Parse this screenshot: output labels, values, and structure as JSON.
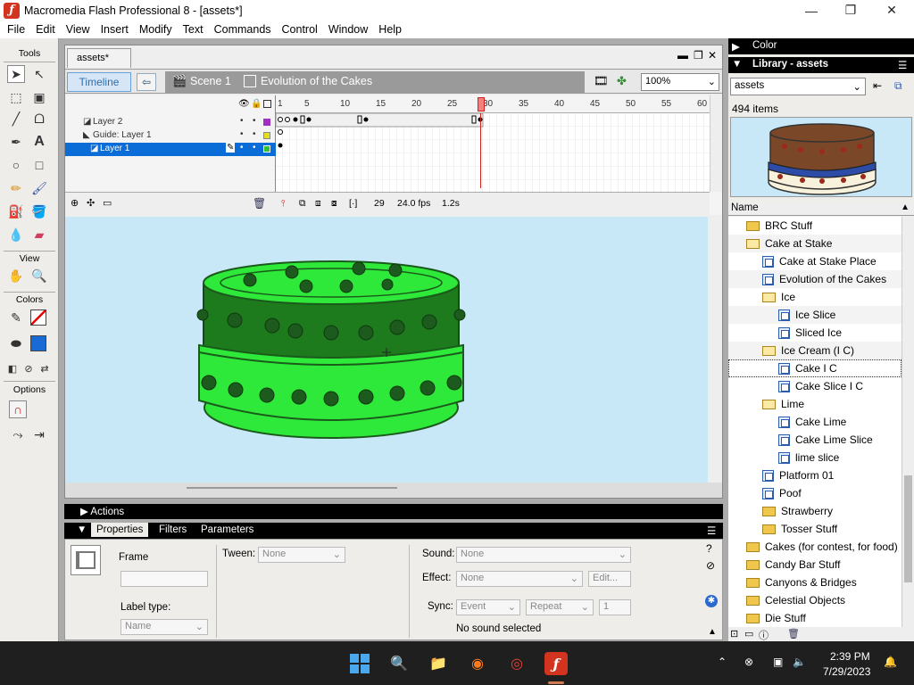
{
  "window": {
    "title": "Macromedia Flash Professional 8 - [assets*]",
    "minimize": "—",
    "maximize": "❐",
    "close": "✕"
  },
  "menu": [
    "File",
    "Edit",
    "View",
    "Insert",
    "Modify",
    "Text",
    "Commands",
    "Control",
    "Window",
    "Help"
  ],
  "tools": {
    "title": "Tools",
    "view": "View",
    "colors": "Colors",
    "options": "Options"
  },
  "document": {
    "tab": "assets*",
    "timeline_button": "Timeline",
    "scene": "Scene 1",
    "symbol": "Evolution of the Cakes",
    "zoom": "100%"
  },
  "timeline": {
    "layers": [
      "Layer 2",
      "Guide: Layer 1",
      "Layer 1"
    ],
    "ruler": [
      "1",
      "5",
      "10",
      "15",
      "20",
      "25",
      "30",
      "35",
      "40",
      "45",
      "50",
      "55",
      "60"
    ],
    "current_frame": "29",
    "fps": "24.0 fps",
    "time": "1.2s"
  },
  "panels": {
    "actions": "Actions",
    "tabs": [
      "Properties",
      "Filters",
      "Parameters"
    ]
  },
  "properties": {
    "frame_label": "Frame",
    "tween_label": "Tween:",
    "tween_value": "None",
    "label_type_label": "Label type:",
    "label_type_value": "Name",
    "sound_label": "Sound:",
    "sound_value": "None",
    "effect_label": "Effect:",
    "effect_value": "None",
    "edit_button": "Edit...",
    "sync_label": "Sync:",
    "sync_value": "Event",
    "repeat_value": "Repeat",
    "repeat_count": "1",
    "status": "No sound selected"
  },
  "right": {
    "color_title": "Color",
    "library_title": "Library - assets",
    "library_select": "assets",
    "item_count": "494 items",
    "column_name": "Name",
    "items": [
      {
        "label": "BRC Stuff",
        "type": "folder",
        "indent": 1
      },
      {
        "label": "Cake at Stake",
        "type": "folder-open",
        "indent": 1
      },
      {
        "label": "Cake at Stake Place",
        "type": "symbol",
        "indent": 2
      },
      {
        "label": "Evolution of the Cakes",
        "type": "symbol",
        "indent": 2
      },
      {
        "label": "Ice",
        "type": "folder-open",
        "indent": 2
      },
      {
        "label": "Ice Slice",
        "type": "symbol",
        "indent": 3
      },
      {
        "label": "Sliced Ice",
        "type": "symbol",
        "indent": 3
      },
      {
        "label": "Ice Cream (I C)",
        "type": "folder-open",
        "indent": 2
      },
      {
        "label": "Cake I C",
        "type": "symbol",
        "indent": 3
      },
      {
        "label": "Cake Slice I C",
        "type": "symbol",
        "indent": 3
      },
      {
        "label": "Lime",
        "type": "folder-open",
        "indent": 2
      },
      {
        "label": "Cake Lime",
        "type": "symbol",
        "indent": 3
      },
      {
        "label": "Cake Lime Slice",
        "type": "symbol",
        "indent": 3
      },
      {
        "label": "lime slice",
        "type": "symbol",
        "indent": 3
      },
      {
        "label": "Platform 01",
        "type": "symbol",
        "indent": 2
      },
      {
        "label": "Poof",
        "type": "symbol",
        "indent": 2
      },
      {
        "label": "Strawberry",
        "type": "folder",
        "indent": 2
      },
      {
        "label": "Tosser Stuff",
        "type": "folder",
        "indent": 2
      },
      {
        "label": "Cakes (for contest, for food)",
        "type": "folder",
        "indent": 1
      },
      {
        "label": "Candy Bar Stuff",
        "type": "folder",
        "indent": 1
      },
      {
        "label": "Canyons & Bridges",
        "type": "folder",
        "indent": 1
      },
      {
        "label": "Celestial Objects",
        "type": "folder",
        "indent": 1
      },
      {
        "label": "Die Stuff",
        "type": "folder",
        "indent": 1
      }
    ]
  },
  "taskbar": {
    "time": "2:39 PM",
    "date": "7/29/2023"
  },
  "colors": {
    "stage": "#c9e8f7",
    "cake_light": "#2ee83a",
    "cake_dark": "#1d7a1d",
    "selection": "#0a6cd6"
  }
}
